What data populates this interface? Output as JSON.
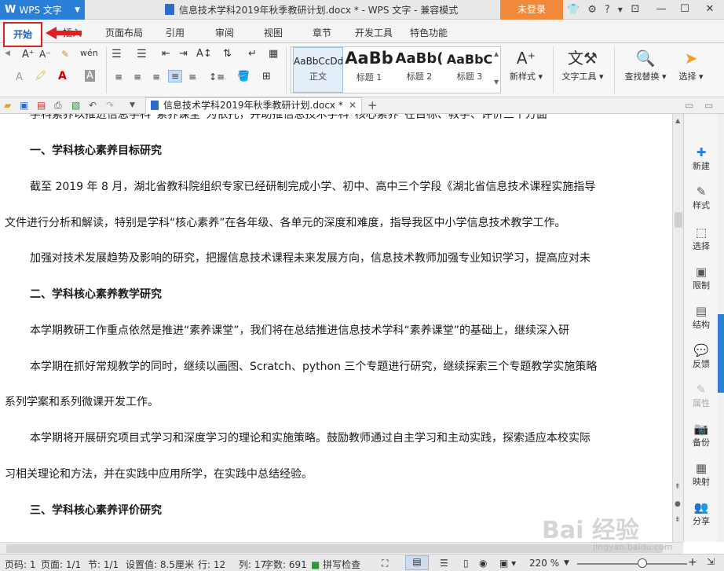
{
  "titlebar": {
    "app_name": "WPS 文字",
    "doc_title": "信息技术学科2019年秋季教研计划.docx * - WPS 文字 - 兼容模式",
    "login": "未登录"
  },
  "tabs": [
    "开始",
    "插入",
    "页面布局",
    "引用",
    "审阅",
    "视图",
    "章节",
    "开发工具",
    "特色功能"
  ],
  "ribbon": {
    "styles": [
      {
        "preview": "AaBbCcDd",
        "label": "正文"
      },
      {
        "preview": "AaBb",
        "label": "标题 1"
      },
      {
        "preview": "AaBb(",
        "label": "标题 2"
      },
      {
        "preview": "AaBbC",
        "label": "标题 3"
      }
    ],
    "new_style": "新样式",
    "text_tool": "文字工具",
    "find_replace": "查找替换",
    "select": "选择"
  },
  "doc_tab": "信息技术学科2019年秋季教研计划.docx *",
  "document": {
    "top_partial": "学科素养以推进信息学科“素养课堂”为依托，并助推信息技术学科“核心素养”在目标、教学、评价三个方面",
    "h1": "一、学科核心素养目标研究",
    "p1a": "截至 2019 年 8 月，湖北省教科院组织专家已经研制完成小学、初中、高中三个学段《湖北省信息技术课程实施指导",
    "p1b": "文件进行分析和解读，特别是学科“核心素养”在各年级、各单元的深度和难度，指导我区中小学信息技术教学工作。",
    "p2": "加强对技术发展趋势及影响的研究，把握信息技术课程未来发展方向，信息技术教师加强专业知识学习，提高应对未",
    "h2": "二、学科核心素养教学研究",
    "p3": "本学期教研工作重点依然是推进“素养课堂”，我们将在总结推进信息技术学科“素养课堂”的基础上，继续深入研",
    "p4a": "本学期在抓好常规教学的同时，继续以画图、Scratch、python 三个专题进行研究，继续探索三个专题教学实施策略",
    "p4b": "系列学案和系列微课开发工作。",
    "p5a": "本学期将开展研究项目式学习和深度学习的理论和实施策略。鼓励教师通过自主学习和主动实践，探索适应本校实际",
    "p5b": "习相关理论和方法，并在实践中应用所学，在实践中总结经验。",
    "h3": "三、学科核心素养评价研究"
  },
  "sidebar": [
    "新建",
    "样式",
    "选择",
    "限制",
    "结构",
    "反馈",
    "属性",
    "备份",
    "映射",
    "分享"
  ],
  "status": {
    "page_num": "页码: 1",
    "pages": "页面: 1/1",
    "section": "节: 1/1",
    "setting": "设置值: 8.5厘米",
    "row": "行: 12",
    "col": "列: 17",
    "words": "字数: 691",
    "spell": "拼写检查",
    "zoom": "220 %"
  },
  "watermark": {
    "main": "Bai 经验",
    "url": "jingyan.baidu.com"
  }
}
